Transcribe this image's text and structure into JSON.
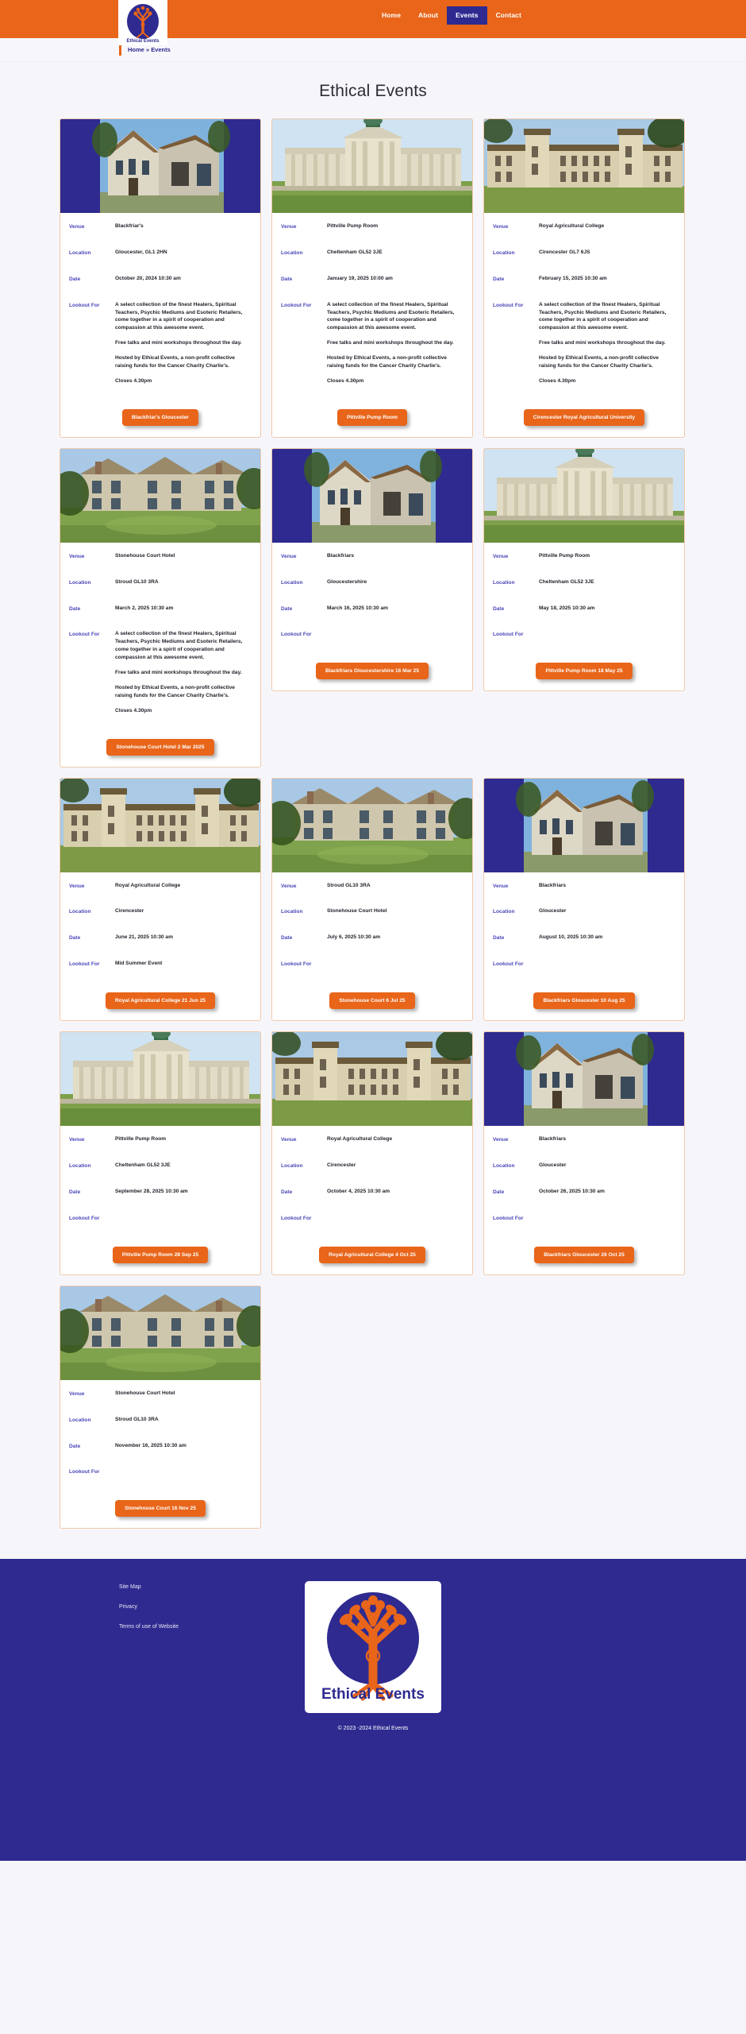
{
  "site": {
    "brand": "Ethical Events",
    "accent_orange": "#e8651a",
    "accent_blue": "#2e2a90"
  },
  "header": {
    "logo_alt": "Ethical Events logo",
    "nav": [
      {
        "label": "Home",
        "active": false
      },
      {
        "label": "About",
        "active": false
      },
      {
        "label": "Events",
        "active": true
      },
      {
        "label": "Contact",
        "active": false
      }
    ]
  },
  "breadcrumb": {
    "home": "Home",
    "separator": "»",
    "current": "Events"
  },
  "page": {
    "title": "Ethical Events"
  },
  "labels": {
    "venue": "Venue",
    "location": "Location",
    "date": "Date",
    "lookout_for": "Lookout For"
  },
  "common_text": {
    "blurb_p1": "A select collection of the finest Healers, Spiritual Teachers, Psychic Mediums and Esoteric Retailers, come together in a spirit of cooperation and compassion at this awesome event.",
    "blurb_p2": "Free talks and mini workshops throughout the day.",
    "blurb_p3": "Hosted by Ethical Events, a non-profit collective raising funds for the Cancer Charity Charlie's.",
    "closes": "Closes 4.30pm"
  },
  "events": [
    {
      "photo": "blackfriars",
      "venue": "Blackfriar's",
      "location": "Gloucester, GL1 2HN",
      "date": "October 20, 2024 10:30 am",
      "lookout": [
        "A select collection of the finest Healers, Spiritual Teachers, Psychic Mediums and Esoteric Retailers, come together in a spirit of cooperation and compassion at this awesome event.",
        "Free talks and mini workshops throughout the day.",
        "Hosted by Ethical Events, a non-profit collective raising funds for the Cancer Charity Charlie's.",
        "Closes 4.30pm"
      ],
      "button": "Blackfriar's Gloucester"
    },
    {
      "photo": "pittville",
      "venue": "Pittville Pump Room",
      "location": "Cheltenham GL52 3JE",
      "date": "January 19, 2025 10:00 am",
      "lookout": [
        "A select collection of the finest Healers, Spiritual Teachers, Psychic Mediums and Esoteric Retailers, come together in a spirit of cooperation and compassion at this awesome event.",
        "Free talks and mini workshops throughout the day.",
        "Hosted by Ethical Events, a non-profit collective raising funds for the Cancer Charity Charlie's.",
        "Closes 4.30pm"
      ],
      "button": "Pittville Pump Room"
    },
    {
      "photo": "royalag",
      "venue": "Royal Agricultural College",
      "location": "Cirencester GL7 6JS",
      "date": "February 15, 2025 10:30 am",
      "lookout": [
        "A select collection of the finest Healers, Spiritual Teachers, Psychic Mediums and Esoteric Retailers, come together in a spirit of cooperation and compassion at this awesome event.",
        "Free talks and mini workshops throughout the day.",
        "Hosted by Ethical Events, a non-profit collective raising funds for the Cancer Charity Charlie's.",
        "Closes 4.30pm"
      ],
      "button": "Cirencester Royal Agricultural University"
    },
    {
      "photo": "stonehouse",
      "venue": "Stonehouse Court Hotel",
      "location": "Stroud GL10 3RA",
      "date": "March 2, 2025 10:30 am",
      "lookout": [
        "A select collection of the finest Healers, Spiritual Teachers, Psychic Mediums and Esoteric Retailers, come together in a spirit of cooperation and compassion at this awesome event.",
        "Free talks and mini workshops throughout the day.",
        "Hosted by Ethical Events, a non-profit collective raising funds for the Cancer Charity Charlie's.",
        "Closes 4.30pm"
      ],
      "button": "Stonehouse Court Hotel 2 Mar 2025"
    },
    {
      "photo": "blackfriars",
      "venue": "Blackfriars",
      "location": "Gloucestershire",
      "date": "March 16, 2025 10:30 am",
      "lookout": [],
      "button": "Blackfriars Gloucestershire 16 Mar 25"
    },
    {
      "photo": "pittville",
      "venue": "Pittville Pump Room",
      "location": "Cheltenham GL52 3JE",
      "date": "May 18, 2025 10:30 am",
      "lookout": [],
      "button": "Pittville Pump Room 18 May 25"
    },
    {
      "photo": "royalag",
      "venue": "Royal Agricultural College",
      "location": "Cirencester",
      "date": "June 21, 2025 10:30 am",
      "lookout": [
        "Mid Summer Event"
      ],
      "button": "Royal Agricultural College 21 Jun 25"
    },
    {
      "photo": "stonehouse",
      "venue": "Stroud GL10 3RA",
      "location": "Stonehouse Court Hotel",
      "date": "July 6, 2025 10:30 am",
      "lookout": [],
      "button": "Stonehouse Court 6 Jul 25"
    },
    {
      "photo": "blackfriars",
      "venue": "Blackfriars",
      "location": "Gloucester",
      "date": "August 10, 2025 10:30 am",
      "lookout": [],
      "button": "Blackfriars Gloucester 10 Aug 25"
    },
    {
      "photo": "pittville",
      "venue": "Pittville Pump Room",
      "location": "Cheltenham GL52 3JE",
      "date": "September 28, 2025 10:30 am",
      "lookout": [],
      "button": "Pittville Pump Room 28 Sep 25"
    },
    {
      "photo": "royalag",
      "venue": "Royal Agricultural College",
      "location": "Cirencester",
      "date": "October 4, 2025 10:30 am",
      "lookout": [],
      "button": "Royal Agricultural College 4 Oct 25"
    },
    {
      "photo": "blackfriars",
      "venue": "Blackfriars",
      "location": "Gloucester",
      "date": "October 26, 2025 10:30 am",
      "lookout": [],
      "button": "Blackfriars Gloucester 26 Oct 25"
    },
    {
      "photo": "stonehouse",
      "venue": "Stonehouse Court Hotel",
      "location": "Stroud GL10 3RA",
      "date": "November 16, 2025 10:30 am",
      "lookout": [],
      "button": "Stonehouse Court 16 Nov 25"
    }
  ],
  "footer": {
    "links": [
      {
        "label": "Site Map"
      },
      {
        "label": "Privacy"
      },
      {
        "label": "Terms of use of Website"
      }
    ],
    "logo_alt": "Ethical Events logo",
    "copyright": "© 2023 -2024 Ethical Events"
  }
}
